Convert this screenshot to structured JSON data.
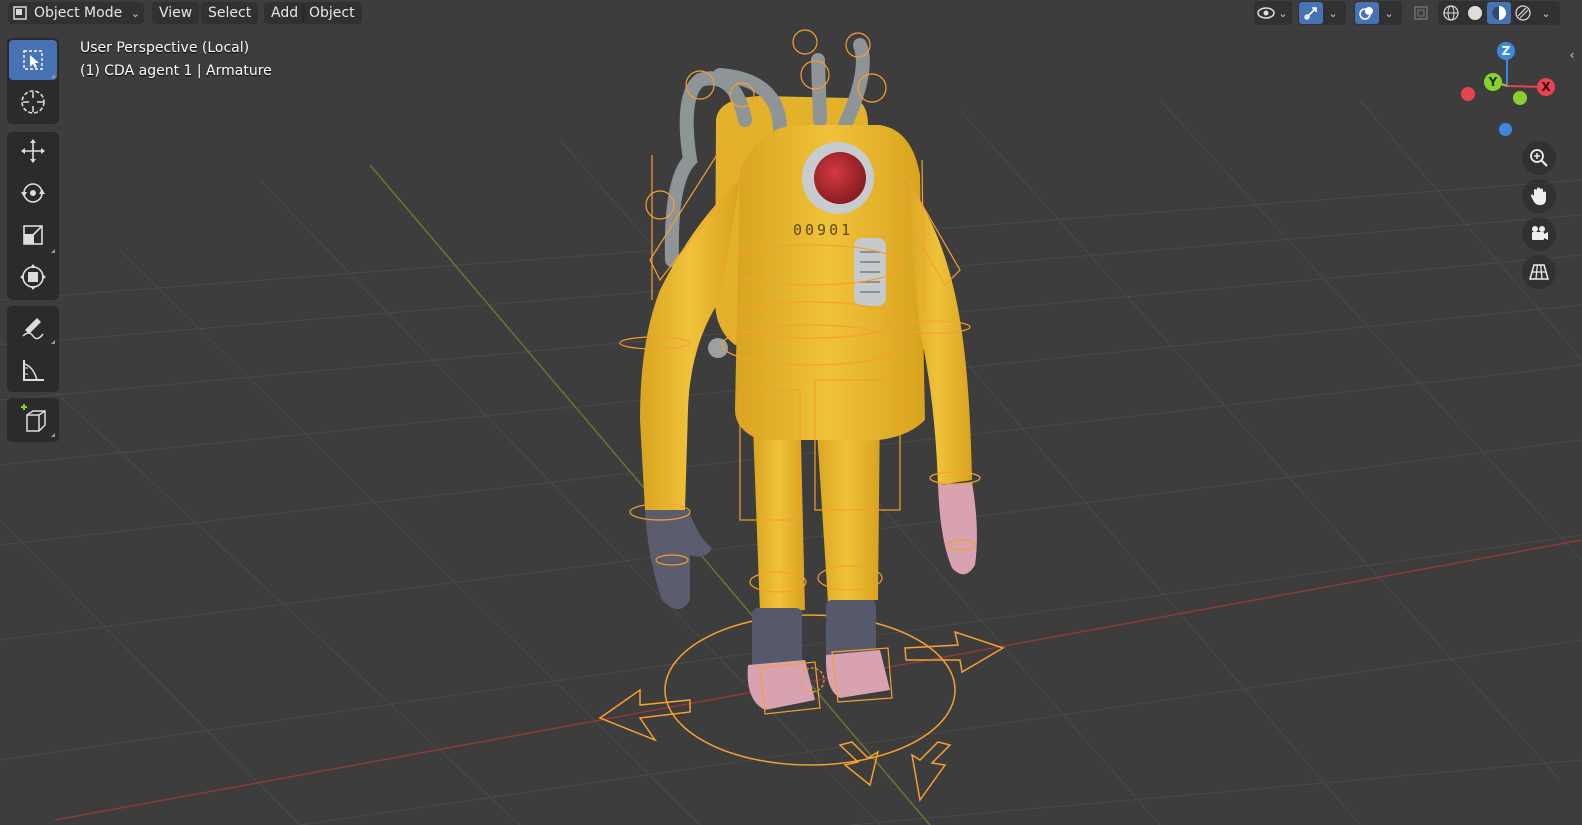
{
  "header": {
    "mode_label": "Object Mode",
    "menus": [
      "View",
      "Select",
      "Add",
      "Object"
    ]
  },
  "toolbar": {
    "tools": [
      {
        "name": "select-box",
        "active": true
      },
      {
        "name": "cursor"
      },
      {
        "name": "move"
      },
      {
        "name": "rotate"
      },
      {
        "name": "scale"
      },
      {
        "name": "transform"
      },
      {
        "name": "annotate"
      },
      {
        "name": "measure"
      },
      {
        "name": "add-cube"
      }
    ]
  },
  "overlay": {
    "view_name": "User Perspective (Local)",
    "object_info": "(1) CDA agent 1 | Armature"
  },
  "model": {
    "chest_number": "00901",
    "suit_color": "#e8b52b",
    "bone_color": "#f5a030"
  },
  "gizmo": {
    "x_label": "X",
    "y_label": "Y",
    "z_label": "Z",
    "x_color": "#e8434f",
    "y_color": "#8bd12e",
    "z_color": "#3c88e0"
  },
  "colors": {
    "viewport_bg": "#3d3d3d",
    "grid_line": "#4a4a4a",
    "x_axis_line": "#8c3a3a",
    "y_axis_line": "#5e7a33",
    "active_tool": "#4772b3"
  }
}
